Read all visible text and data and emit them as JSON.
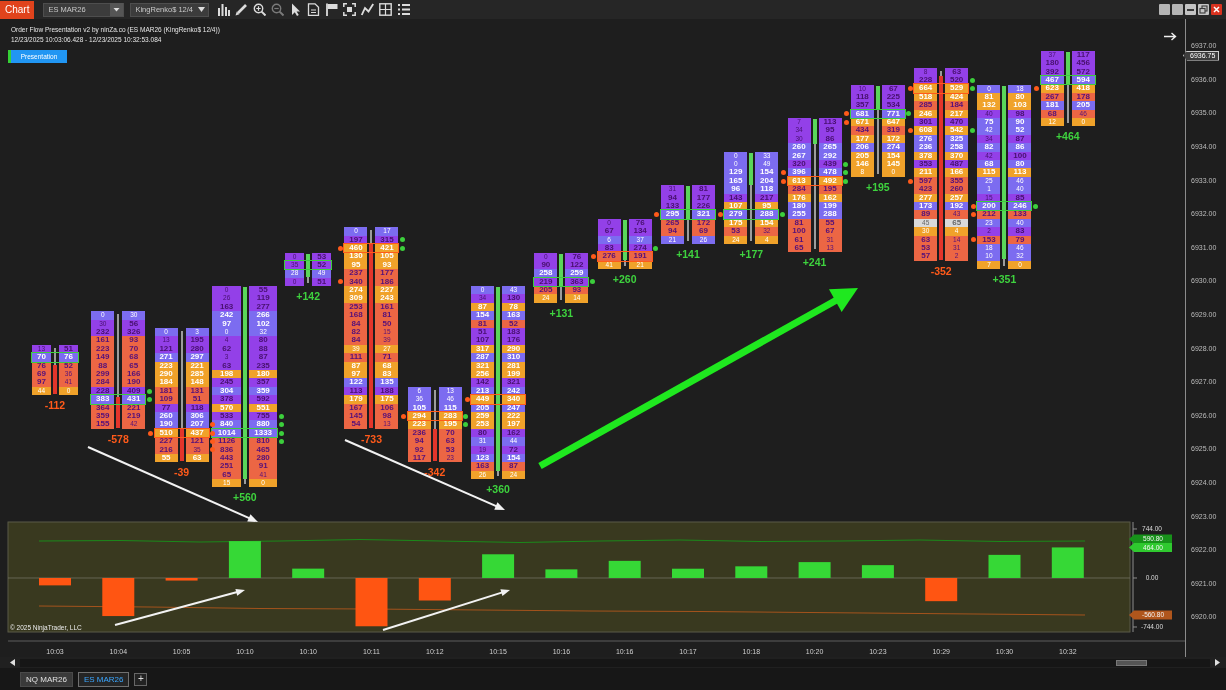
{
  "toolbar": {
    "app_tab": "Chart",
    "instrument": "ES MAR26",
    "bar_type": "KingRenko$ 12/4"
  },
  "chart": {
    "title": "Order Flow Presentation v2 by ninZa.co (ES MAR26 (KingRenko$ 12/4))",
    "time_range": "12/23/2025 10:03:06.428 - 12/23/2025 10:32:53.084",
    "button": "Presentation",
    "bars": [
      {
        "kind": "down",
        "delta": "-112",
        "level": 0.6,
        "rows": [
          {
            "bid": "13",
            "ask": "51",
            "color": "#9340e8"
          },
          {
            "bid": "70",
            "ask": "76",
            "color": "#7c6cf0",
            "outline": {
              "color": "#3ccf3c"
            }
          },
          {
            "bid": "76",
            "ask": "52",
            "color": "#ec6644"
          },
          {
            "bid": "69",
            "ask": "36",
            "color": "#ec6644"
          },
          {
            "bid": "97",
            "ask": "41",
            "color": "#ec6644"
          },
          {
            "bid": "44",
            "ask": "0",
            "color": "#f0a22a"
          }
        ]
      },
      {
        "kind": "down",
        "delta": "-578",
        "level": 0.27,
        "rows": [
          {
            "bid": "0",
            "ask": "30",
            "color": "#7c6cf0"
          },
          {
            "bid": "30",
            "ask": "56",
            "color": "#9340e8"
          },
          {
            "bid": "232",
            "ask": "326",
            "color": "#9340e8"
          },
          {
            "bid": "161",
            "ask": "93",
            "color": "#ec6644"
          },
          {
            "bid": "223",
            "ask": "70",
            "color": "#ec6644"
          },
          {
            "bid": "149",
            "ask": "68",
            "color": "#ec6644"
          },
          {
            "bid": "88",
            "ask": "65",
            "color": "#ec6644"
          },
          {
            "bid": "299",
            "ask": "166",
            "color": "#ec6644"
          },
          {
            "bid": "284",
            "ask": "190",
            "color": "#ec6644"
          },
          {
            "bid": "228",
            "ask": "409",
            "color": "#9340e8",
            "dots": [
              {
                "kind": "right",
                "color": "#3ccf3c"
              }
            ]
          },
          {
            "bid": "383",
            "ask": "431",
            "color": "#7c6cf0",
            "outline": {
              "color": "#3ccf3c"
            },
            "dots": [
              {
                "kind": "right",
                "color": "#3ccf3c"
              }
            ]
          },
          {
            "bid": "364",
            "ask": "221",
            "color": "#ec6644"
          },
          {
            "bid": "359",
            "ask": "219",
            "color": "#ec6644"
          },
          {
            "bid": "155",
            "ask": "42",
            "color": "#ec6644"
          }
        ]
      },
      {
        "kind": "down",
        "delta": "-39",
        "level": 0.25,
        "rows": [
          {
            "bid": "0",
            "ask": "3",
            "color": "#7c6cf0"
          },
          {
            "bid": "13",
            "ask": "195",
            "color": "#9340e8"
          },
          {
            "bid": "121",
            "ask": "280",
            "color": "#9340e8"
          },
          {
            "bid": "271",
            "ask": "297",
            "color": "#7c6cf0"
          },
          {
            "bid": "223",
            "ask": "221",
            "color": "#f0a22a"
          },
          {
            "bid": "290",
            "ask": "285",
            "color": "#f0a22a"
          },
          {
            "bid": "184",
            "ask": "148",
            "color": "#f0a22a"
          },
          {
            "bid": "181",
            "ask": "131",
            "color": "#ec6644"
          },
          {
            "bid": "109",
            "ask": "51",
            "color": "#ec6644"
          },
          {
            "bid": "77",
            "ask": "118",
            "color": "#9340e8"
          },
          {
            "bid": "260",
            "ask": "306",
            "color": "#7c6cf0"
          },
          {
            "bid": "190",
            "ask": "207",
            "color": "#7c6cf0",
            "dots": [
              {
                "kind": "right",
                "color": "#ff5a1a"
              }
            ]
          },
          {
            "bid": "510",
            "ask": "437",
            "color": "#f0a22a",
            "outline": {
              "color": "#ff5a1a"
            },
            "dots": [
              {
                "kind": "left",
                "color": "#ff5a1a"
              },
              {
                "kind": "right",
                "color": "#ff5a1a"
              }
            ]
          },
          {
            "bid": "227",
            "ask": "121",
            "color": "#ec6644",
            "dots": [
              {
                "kind": "right",
                "color": "#ff5a1a"
              }
            ]
          },
          {
            "bid": "216",
            "ask": "35",
            "color": "#ec6644",
            "dots": [
              {
                "kind": "right",
                "color": "#ff5a1a"
              }
            ]
          },
          {
            "bid": "55",
            "ask": "63",
            "color": "#f0a22a"
          }
        ]
      },
      {
        "kind": "up",
        "delta": "+560",
        "level": 0.96,
        "rows": [
          {
            "bid": "0",
            "ask": "55",
            "color": "#9340e8"
          },
          {
            "bid": "26",
            "ask": "119",
            "color": "#9340e8"
          },
          {
            "bid": "163",
            "ask": "277",
            "color": "#9340e8"
          },
          {
            "bid": "242",
            "ask": "266",
            "color": "#7c6cf0"
          },
          {
            "bid": "97",
            "ask": "102",
            "color": "#7c6cf0"
          },
          {
            "bid": "0",
            "ask": "32",
            "color": "#7c6cf0"
          },
          {
            "bid": "4",
            "ask": "80",
            "color": "#9340e8"
          },
          {
            "bid": "62",
            "ask": "88",
            "color": "#9340e8"
          },
          {
            "bid": "3",
            "ask": "87",
            "color": "#9340e8"
          },
          {
            "bid": "63",
            "ask": "235",
            "color": "#9340e8"
          },
          {
            "bid": "198",
            "ask": "180",
            "color": "#f0a22a"
          },
          {
            "bid": "245",
            "ask": "357",
            "color": "#9340e8"
          },
          {
            "bid": "304",
            "ask": "359",
            "color": "#7c6cf0"
          },
          {
            "bid": "378",
            "ask": "592",
            "color": "#9340e8"
          },
          {
            "bid": "570",
            "ask": "551",
            "color": "#f0a22a"
          },
          {
            "bid": "533",
            "ask": "755",
            "color": "#9340e8",
            "dots": [
              {
                "kind": "right",
                "color": "#3ccf3c"
              }
            ]
          },
          {
            "bid": "840",
            "ask": "880",
            "color": "#7c6cf0",
            "dots": [
              {
                "kind": "right",
                "color": "#3ccf3c"
              }
            ]
          },
          {
            "bid": "1014",
            "ask": "1333",
            "color": "#7c6cf0",
            "outline": {
              "color": "#3ccf3c"
            },
            "dots": [
              {
                "kind": "right",
                "color": "#3ccf3c"
              }
            ]
          },
          {
            "bid": "1126",
            "ask": "810",
            "color": "#ec6644",
            "dots": [
              {
                "kind": "right",
                "color": "#3ccf3c"
              }
            ]
          },
          {
            "bid": "836",
            "ask": "465",
            "color": "#ec6644"
          },
          {
            "bid": "443",
            "ask": "280",
            "color": "#ec6644"
          },
          {
            "bid": "251",
            "ask": "91",
            "color": "#ec6644"
          },
          {
            "bid": "65",
            "ask": "41",
            "color": "#ec6644"
          },
          {
            "bid": "15",
            "ask": "0",
            "color": "#f0a22a"
          }
        ]
      },
      {
        "kind": "up",
        "delta": "+142",
        "level": 0.75,
        "rows": [
          {
            "bid": "0",
            "ask": "53",
            "color": "#9340e8"
          },
          {
            "bid": "35",
            "ask": "52",
            "color": "#9340e8",
            "outline": {
              "color": "#3ccf3c"
            }
          },
          {
            "bid": "28",
            "ask": "49",
            "color": "#7c6cf0"
          },
          {
            "bid": "0",
            "ask": "51",
            "color": "#9340e8"
          }
        ]
      },
      {
        "kind": "down",
        "delta": "-733",
        "level": 0.92,
        "rows": [
          {
            "bid": "0",
            "ask": "17",
            "color": "#7c6cf0"
          },
          {
            "bid": "197",
            "ask": "315",
            "color": "#9340e8",
            "dots": [
              {
                "kind": "right",
                "color": "#3ccf3c"
              }
            ]
          },
          {
            "bid": "460",
            "ask": "421",
            "color": "#f0a22a",
            "outline": {
              "color": "#ff5a1a"
            },
            "dots": [
              {
                "kind": "left",
                "color": "#ff5a1a"
              },
              {
                "kind": "right",
                "color": "#3ccf3c"
              }
            ]
          },
          {
            "bid": "130",
            "ask": "105",
            "color": "#f0a22a"
          },
          {
            "bid": "95",
            "ask": "93",
            "color": "#f0a22a"
          },
          {
            "bid": "237",
            "ask": "177",
            "color": "#ec6644"
          },
          {
            "bid": "340",
            "ask": "186",
            "color": "#ec6644",
            "dots": [
              {
                "kind": "left",
                "color": "#ff5a1a"
              }
            ]
          },
          {
            "bid": "274",
            "ask": "227",
            "color": "#f0a22a"
          },
          {
            "bid": "309",
            "ask": "243",
            "color": "#f0a22a"
          },
          {
            "bid": "253",
            "ask": "161",
            "color": "#ec6644"
          },
          {
            "bid": "168",
            "ask": "81",
            "color": "#ec6644"
          },
          {
            "bid": "84",
            "ask": "50",
            "color": "#ec6644"
          },
          {
            "bid": "82",
            "ask": "15",
            "color": "#ec6644"
          },
          {
            "bid": "84",
            "ask": "39",
            "color": "#ec6644"
          },
          {
            "bid": "39",
            "ask": "27",
            "color": "#f0a22a"
          },
          {
            "bid": "111",
            "ask": "71",
            "color": "#ec6644"
          },
          {
            "bid": "87",
            "ask": "68",
            "color": "#f0a22a"
          },
          {
            "bid": "97",
            "ask": "83",
            "color": "#f0a22a"
          },
          {
            "bid": "122",
            "ask": "135",
            "color": "#7c6cf0"
          },
          {
            "bid": "113",
            "ask": "188",
            "color": "#9340e8"
          },
          {
            "bid": "179",
            "ask": "175",
            "color": "#f0a22a"
          },
          {
            "bid": "167",
            "ask": "106",
            "color": "#ec6644"
          },
          {
            "bid": "145",
            "ask": "98",
            "color": "#ec6644"
          },
          {
            "bid": "54",
            "ask": "13",
            "color": "#ec6644"
          }
        ]
      },
      {
        "kind": "down",
        "delta": "-342",
        "level": 0.44,
        "rows": [
          {
            "bid": "6",
            "ask": "13",
            "color": "#7c6cf0"
          },
          {
            "bid": "36",
            "ask": "46",
            "color": "#7c6cf0"
          },
          {
            "bid": "105",
            "ask": "115",
            "color": "#7c6cf0"
          },
          {
            "bid": "294",
            "ask": "283",
            "color": "#f0a22a",
            "outline": {
              "color": "#ff5a1a"
            },
            "dots": [
              {
                "kind": "left",
                "color": "#ff5a1a"
              },
              {
                "kind": "right",
                "color": "#3ccf3c"
              }
            ]
          },
          {
            "bid": "223",
            "ask": "195",
            "color": "#f0a22a",
            "dots": [
              {
                "kind": "right",
                "color": "#3ccf3c"
              }
            ]
          },
          {
            "bid": "236",
            "ask": "70",
            "color": "#ec6644"
          },
          {
            "bid": "94",
            "ask": "63",
            "color": "#ec6644"
          },
          {
            "bid": "92",
            "ask": "53",
            "color": "#ec6644"
          },
          {
            "bid": "117",
            "ask": "23",
            "color": "#ec6644"
          }
        ]
      },
      {
        "kind": "up",
        "delta": "+360",
        "level": 0.96,
        "rows": [
          {
            "bid": "0",
            "ask": "43",
            "color": "#7c6cf0"
          },
          {
            "bid": "34",
            "ask": "130",
            "color": "#9340e8"
          },
          {
            "bid": "87",
            "ask": "78",
            "color": "#f0a22a"
          },
          {
            "bid": "154",
            "ask": "163",
            "color": "#7c6cf0"
          },
          {
            "bid": "81",
            "ask": "52",
            "color": "#ec6644"
          },
          {
            "bid": "51",
            "ask": "183",
            "color": "#9340e8"
          },
          {
            "bid": "107",
            "ask": "176",
            "color": "#9340e8"
          },
          {
            "bid": "317",
            "ask": "290",
            "color": "#f0a22a"
          },
          {
            "bid": "287",
            "ask": "310",
            "color": "#7c6cf0"
          },
          {
            "bid": "321",
            "ask": "281",
            "color": "#f0a22a"
          },
          {
            "bid": "256",
            "ask": "199",
            "color": "#f0a22a"
          },
          {
            "bid": "142",
            "ask": "321",
            "color": "#9340e8"
          },
          {
            "bid": "213",
            "ask": "242",
            "color": "#7c6cf0"
          },
          {
            "bid": "449",
            "ask": "340",
            "color": "#f0a22a",
            "outline": {
              "color": "#ff5a1a"
            },
            "dots": [
              {
                "kind": "left",
                "color": "#ff5a1a"
              }
            ]
          },
          {
            "bid": "205",
            "ask": "247",
            "color": "#7c6cf0"
          },
          {
            "bid": "259",
            "ask": "222",
            "color": "#f0a22a"
          },
          {
            "bid": "253",
            "ask": "197",
            "color": "#f0a22a"
          },
          {
            "bid": "80",
            "ask": "162",
            "color": "#9340e8"
          },
          {
            "bid": "31",
            "ask": "44",
            "color": "#7c6cf0"
          },
          {
            "bid": "19",
            "ask": "72",
            "color": "#9340e8"
          },
          {
            "bid": "123",
            "ask": "154",
            "color": "#7c6cf0"
          },
          {
            "bid": "163",
            "ask": "87",
            "color": "#ec6644"
          },
          {
            "bid": "26",
            "ask": "24",
            "color": "#f0a22a"
          }
        ]
      },
      {
        "kind": "up",
        "delta": "+131",
        "level": 0.67,
        "rows": [
          {
            "bid": "0",
            "ask": "76",
            "color": "#9340e8"
          },
          {
            "bid": "90",
            "ask": "122",
            "color": "#9340e8"
          },
          {
            "bid": "258",
            "ask": "259",
            "color": "#7c6cf0"
          },
          {
            "bid": "219",
            "ask": "363",
            "color": "#9340e8",
            "outline": {
              "color": "#3ccf3c"
            },
            "dots": [
              {
                "kind": "right",
                "color": "#3ccf3c"
              }
            ]
          },
          {
            "bid": "205",
            "ask": "93",
            "color": "#ec6644"
          },
          {
            "bid": "24",
            "ask": "14",
            "color": "#f0a22a"
          }
        ]
      },
      {
        "kind": "up",
        "delta": "+260",
        "level": 0.83,
        "rows": [
          {
            "bid": "0",
            "ask": "76",
            "color": "#9340e8"
          },
          {
            "bid": "67",
            "ask": "134",
            "color": "#9340e8"
          },
          {
            "bid": "6",
            "ask": "37",
            "color": "#7c6cf0"
          },
          {
            "bid": "83",
            "ask": "274",
            "color": "#9340e8",
            "dots": [
              {
                "kind": "right",
                "color": "#3ccf3c"
              }
            ]
          },
          {
            "bid": "276",
            "ask": "191",
            "color": "#ec6644",
            "outline": {
              "color": "#ff5a1a"
            },
            "dots": [
              {
                "kind": "left",
                "color": "#ff5a1a"
              }
            ]
          },
          {
            "bid": "41",
            "ask": "21",
            "color": "#f0a22a"
          }
        ]
      },
      {
        "kind": "up",
        "delta": "+141",
        "level": 0.57,
        "rows": [
          {
            "bid": "31",
            "ask": "81",
            "color": "#9340e8"
          },
          {
            "bid": "94",
            "ask": "177",
            "color": "#9340e8"
          },
          {
            "bid": "133",
            "ask": "226",
            "color": "#9340e8"
          },
          {
            "bid": "295",
            "ask": "321",
            "color": "#7c6cf0",
            "outline": {
              "color": "#3ccf3c"
            },
            "dots": [
              {
                "kind": "left",
                "color": "#ff5a1a"
              }
            ]
          },
          {
            "bid": "265",
            "ask": "172",
            "color": "#ec6644"
          },
          {
            "bid": "94",
            "ask": "69",
            "color": "#ec6644"
          },
          {
            "bid": "21",
            "ask": "26",
            "color": "#7c6cf0"
          }
        ]
      },
      {
        "kind": "up",
        "delta": "+177",
        "level": 0.36,
        "rows": [
          {
            "bid": "0",
            "ask": "33",
            "color": "#7c6cf0"
          },
          {
            "bid": "0",
            "ask": "49",
            "color": "#7c6cf0"
          },
          {
            "bid": "129",
            "ask": "154",
            "color": "#7c6cf0"
          },
          {
            "bid": "165",
            "ask": "204",
            "color": "#7c6cf0"
          },
          {
            "bid": "96",
            "ask": "118",
            "color": "#7c6cf0"
          },
          {
            "bid": "143",
            "ask": "217",
            "color": "#9340e8"
          },
          {
            "bid": "107",
            "ask": "95",
            "color": "#f0a22a"
          },
          {
            "bid": "279",
            "ask": "288",
            "color": "#7c6cf0",
            "outline": {
              "color": "#3ccf3c"
            },
            "dots": [
              {
                "kind": "left",
                "color": "#ff5a1a"
              },
              {
                "kind": "right",
                "color": "#3ccf3c"
              }
            ]
          },
          {
            "bid": "175",
            "ask": "154",
            "color": "#f0a22a"
          },
          {
            "bid": "53",
            "ask": "32",
            "color": "#ec6644"
          },
          {
            "bid": "24",
            "ask": "4",
            "color": "#f0a22a"
          }
        ]
      },
      {
        "kind": "up",
        "delta": "+241",
        "level": 0.19,
        "rows": [
          {
            "bid": "7",
            "ask": "113",
            "color": "#9340e8"
          },
          {
            "bid": "34",
            "ask": "95",
            "color": "#9340e8"
          },
          {
            "bid": "30",
            "ask": "86",
            "color": "#9340e8"
          },
          {
            "bid": "260",
            "ask": "265",
            "color": "#7c6cf0"
          },
          {
            "bid": "267",
            "ask": "292",
            "color": "#7c6cf0"
          },
          {
            "bid": "320",
            "ask": "439",
            "color": "#9340e8",
            "dots": [
              {
                "kind": "right",
                "color": "#3ccf3c"
              }
            ]
          },
          {
            "bid": "396",
            "ask": "478",
            "color": "#7c6cf0",
            "dots": [
              {
                "kind": "left",
                "color": "#ff5a1a"
              },
              {
                "kind": "right",
                "color": "#3ccf3c"
              }
            ]
          },
          {
            "bid": "613",
            "ask": "492",
            "color": "#f0a22a",
            "outline": {
              "color": "#ff5a1a"
            },
            "dots": [
              {
                "kind": "left",
                "color": "#ff5a1a"
              },
              {
                "kind": "right",
                "color": "#3ccf3c"
              }
            ]
          },
          {
            "bid": "284",
            "ask": "195",
            "color": "#ec6644"
          },
          {
            "bid": "176",
            "ask": "162",
            "color": "#f0a22a"
          },
          {
            "bid": "180",
            "ask": "199",
            "color": "#7c6cf0"
          },
          {
            "bid": "255",
            "ask": "288",
            "color": "#7c6cf0"
          },
          {
            "bid": "81",
            "ask": "55",
            "color": "#ec6644"
          },
          {
            "bid": "100",
            "ask": "67",
            "color": "#ec6644"
          },
          {
            "bid": "61",
            "ask": "31",
            "color": "#ec6644"
          },
          {
            "bid": "65",
            "ask": "13",
            "color": "#ec6644"
          }
        ]
      },
      {
        "kind": "up",
        "delta": "+195",
        "level": 0.27,
        "rows": [
          {
            "bid": "10",
            "ask": "67",
            "color": "#9340e8"
          },
          {
            "bid": "118",
            "ask": "225",
            "color": "#9340e8"
          },
          {
            "bid": "357",
            "ask": "534",
            "color": "#9340e8"
          },
          {
            "bid": "681",
            "ask": "771",
            "color": "#7c6cf0",
            "outline": {
              "color": "#3ccf3c"
            },
            "dots": [
              {
                "kind": "left",
                "color": "#ff5a1a"
              },
              {
                "kind": "right",
                "color": "#3ccf3c"
              }
            ]
          },
          {
            "bid": "671",
            "ask": "647",
            "color": "#f0a22a",
            "dots": [
              {
                "kind": "left",
                "color": "#ff5a1a"
              }
            ]
          },
          {
            "bid": "434",
            "ask": "319",
            "color": "#ec6644"
          },
          {
            "bid": "177",
            "ask": "172",
            "color": "#f0a22a"
          },
          {
            "bid": "206",
            "ask": "274",
            "color": "#7c6cf0"
          },
          {
            "bid": "205",
            "ask": "154",
            "color": "#f0a22a"
          },
          {
            "bid": "146",
            "ask": "145",
            "color": "#f0a22a"
          },
          {
            "bid": "8",
            "ask": "0",
            "color": "#f0a22a"
          }
        ]
      },
      {
        "kind": "down",
        "delta": "-352",
        "level": 0.96,
        "rows": [
          {
            "bid": "8",
            "ask": "63",
            "color": "#9340e8"
          },
          {
            "bid": "228",
            "ask": "520",
            "color": "#9340e8",
            "dots": [
              {
                "kind": "right",
                "color": "#3ccf3c"
              }
            ]
          },
          {
            "bid": "664",
            "ask": "529",
            "color": "#f0a22a",
            "outline": {
              "color": "#ff5a1a"
            },
            "dots": [
              {
                "kind": "left",
                "color": "#ff5a1a"
              },
              {
                "kind": "right",
                "color": "#3ccf3c"
              }
            ]
          },
          {
            "bid": "518",
            "ask": "424",
            "color": "#f0a22a"
          },
          {
            "bid": "285",
            "ask": "184",
            "color": "#ec6644"
          },
          {
            "bid": "246",
            "ask": "217",
            "color": "#f0a22a"
          },
          {
            "bid": "301",
            "ask": "470",
            "color": "#9340e8"
          },
          {
            "bid": "608",
            "ask": "542",
            "color": "#f0a22a",
            "dots": [
              {
                "kind": "left",
                "color": "#ff5a1a"
              },
              {
                "kind": "right",
                "color": "#3ccf3c"
              }
            ]
          },
          {
            "bid": "276",
            "ask": "325",
            "color": "#7c6cf0"
          },
          {
            "bid": "236",
            "ask": "258",
            "color": "#7c6cf0"
          },
          {
            "bid": "378",
            "ask": "370",
            "color": "#f0a22a"
          },
          {
            "bid": "353",
            "ask": "487",
            "color": "#9340e8"
          },
          {
            "bid": "211",
            "ask": "166",
            "color": "#f0a22a"
          },
          {
            "bid": "597",
            "ask": "355",
            "color": "#ec6644",
            "dots": [
              {
                "kind": "left",
                "color": "#ff5a1a"
              }
            ]
          },
          {
            "bid": "423",
            "ask": "260",
            "color": "#ec6644"
          },
          {
            "bid": "277",
            "ask": "257",
            "color": "#f0a22a"
          },
          {
            "bid": "173",
            "ask": "192",
            "color": "#7c6cf0"
          },
          {
            "bid": "89",
            "ask": "43",
            "color": "#ec6644"
          },
          {
            "bid": "45",
            "ask": "65",
            "color": "#d9d9d9"
          },
          {
            "bid": "30",
            "ask": "4",
            "color": "#f0a22a"
          },
          {
            "bid": "63",
            "ask": "14",
            "color": "#ec6644"
          },
          {
            "bid": "53",
            "ask": "31",
            "color": "#ec6644"
          },
          {
            "bid": "57",
            "ask": "2",
            "color": "#ec6644"
          }
        ]
      },
      {
        "kind": "up",
        "delta": "+351",
        "level": 0.95,
        "rows": [
          {
            "bid": "0",
            "ask": "18",
            "color": "#7c6cf0"
          },
          {
            "bid": "81",
            "ask": "80",
            "color": "#f0a22a"
          },
          {
            "bid": "132",
            "ask": "103",
            "color": "#f0a22a"
          },
          {
            "bid": "40",
            "ask": "98",
            "color": "#9340e8"
          },
          {
            "bid": "75",
            "ask": "90",
            "color": "#7c6cf0"
          },
          {
            "bid": "42",
            "ask": "52",
            "color": "#7c6cf0"
          },
          {
            "bid": "34",
            "ask": "87",
            "color": "#9340e8"
          },
          {
            "bid": "82",
            "ask": "86",
            "color": "#7c6cf0"
          },
          {
            "bid": "42",
            "ask": "100",
            "color": "#9340e8"
          },
          {
            "bid": "68",
            "ask": "80",
            "color": "#7c6cf0"
          },
          {
            "bid": "115",
            "ask": "113",
            "color": "#f0a22a"
          },
          {
            "bid": "25",
            "ask": "46",
            "color": "#7c6cf0"
          },
          {
            "bid": "1",
            "ask": "40",
            "color": "#7c6cf0"
          },
          {
            "bid": "15",
            "ask": "85",
            "color": "#9340e8"
          },
          {
            "bid": "200",
            "ask": "246",
            "color": "#7c6cf0",
            "outline": {
              "color": "#3ccf3c"
            },
            "dots": [
              {
                "kind": "left",
                "color": "#ff5a1a"
              },
              {
                "kind": "right",
                "color": "#3ccf3c"
              }
            ]
          },
          {
            "bid": "212",
            "ask": "133",
            "color": "#ec6644",
            "dots": [
              {
                "kind": "left",
                "color": "#ff5a1a"
              }
            ]
          },
          {
            "bid": "23",
            "ask": "40",
            "color": "#7c6cf0"
          },
          {
            "bid": "2",
            "ask": "83",
            "color": "#9340e8"
          },
          {
            "bid": "153",
            "ask": "79",
            "color": "#ec6644",
            "dots": [
              {
                "kind": "left",
                "color": "#ff5a1a"
              }
            ]
          },
          {
            "bid": "18",
            "ask": "46",
            "color": "#7c6cf0"
          },
          {
            "bid": "10",
            "ask": "32",
            "color": "#7c6cf0"
          },
          {
            "bid": "7",
            "ask": "0",
            "color": "#f0a22a"
          }
        ]
      },
      {
        "kind": "up",
        "delta": "+464",
        "level": 0.44,
        "rows": [
          {
            "bid": "37",
            "ask": "117",
            "color": "#9340e8"
          },
          {
            "bid": "180",
            "ask": "456",
            "color": "#9340e8"
          },
          {
            "bid": "392",
            "ask": "572",
            "color": "#9340e8"
          },
          {
            "bid": "467",
            "ask": "594",
            "color": "#7c6cf0",
            "outline": {
              "color": "#3ccf3c"
            }
          },
          {
            "bid": "623",
            "ask": "418",
            "color": "#f0a22a",
            "dots": [
              {
                "kind": "left",
                "color": "#ff5a1a"
              }
            ]
          },
          {
            "bid": "267",
            "ask": "178",
            "color": "#ec6644"
          },
          {
            "bid": "181",
            "ask": "205",
            "color": "#7c6cf0"
          },
          {
            "bid": "68",
            "ask": "46",
            "color": "#ec6644"
          },
          {
            "bid": "12",
            "ask": "0",
            "color": "#f0a22a"
          }
        ]
      }
    ],
    "price_axis": {
      "labels": [
        "6937.00",
        "6936.00",
        "6935.00",
        "6934.00",
        "6933.00",
        "6932.00",
        "6931.00",
        "6930.00",
        "6929.00",
        "6928.00",
        "6927.00",
        "6926.00",
        "6925.00",
        "6924.00",
        "6923.00",
        "6922.00",
        "6921.00",
        "6920.00"
      ],
      "current": "6936.75"
    }
  },
  "delta_panel": {
    "copyright": "© 2025 NinjaTrader, LLC",
    "chart_data": {
      "type": "bar",
      "categories": [
        "10:03",
        "10:04",
        "10:05",
        "10:10",
        "10:10",
        "10:11",
        "10:12",
        "10:15",
        "10:16",
        "10:16",
        "10:17",
        "10:18",
        "10:20",
        "10:23",
        "10:29",
        "10:30",
        "10:32"
      ],
      "values": [
        -112,
        -578,
        -39,
        560,
        142,
        -733,
        -342,
        360,
        131,
        260,
        141,
        177,
        241,
        195,
        -352,
        351,
        464
      ],
      "ylim": [
        -820,
        850
      ],
      "yticks": [
        {
          "value": 744,
          "label": "744.00"
        },
        {
          "value": 0,
          "label": "0.00"
        },
        {
          "value": -744,
          "label": "-744.00"
        }
      ],
      "annotations": [
        "590.80",
        "464.00",
        "-560.80"
      ]
    }
  },
  "tabs": [
    {
      "label": "NQ MAR26",
      "selected": false
    },
    {
      "label": "ES MAR26",
      "selected": true
    }
  ],
  "add_tab": "+"
}
